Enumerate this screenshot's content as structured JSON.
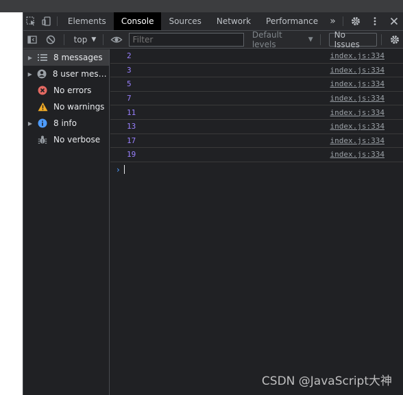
{
  "tabs": {
    "elements": "Elements",
    "console": "Console",
    "sources": "Sources",
    "network": "Network",
    "performance": "Performance",
    "more": "»"
  },
  "toolbar": {
    "context": "top",
    "filter_placeholder": "Filter",
    "levels": "Default levels",
    "issues": "No Issues"
  },
  "sidebar": {
    "items": [
      {
        "label": "8 messages",
        "icon": "list-icon"
      },
      {
        "label": "8 user mess…",
        "icon": "user-icon"
      },
      {
        "label": "No errors",
        "icon": "error-icon"
      },
      {
        "label": "No warnings",
        "icon": "warning-icon"
      },
      {
        "label": "8 info",
        "icon": "info-icon"
      },
      {
        "label": "No verbose",
        "icon": "bug-icon"
      }
    ]
  },
  "console": {
    "messages": [
      {
        "value": "2",
        "source": "index.js:334"
      },
      {
        "value": "3",
        "source": "index.js:334"
      },
      {
        "value": "5",
        "source": "index.js:334"
      },
      {
        "value": "7",
        "source": "index.js:334"
      },
      {
        "value": "11",
        "source": "index.js:334"
      },
      {
        "value": "13",
        "source": "index.js:334"
      },
      {
        "value": "17",
        "source": "index.js:334"
      },
      {
        "value": "19",
        "source": "index.js:334"
      }
    ]
  },
  "watermark": "CSDN @JavaScript大神",
  "colors": {
    "background": "#202124",
    "value_purple": "#9980ff",
    "prompt_blue": "#4e9cff",
    "error_red": "#e46962",
    "warning_yellow": "#f2ab26",
    "info_blue": "#4e9cff"
  }
}
